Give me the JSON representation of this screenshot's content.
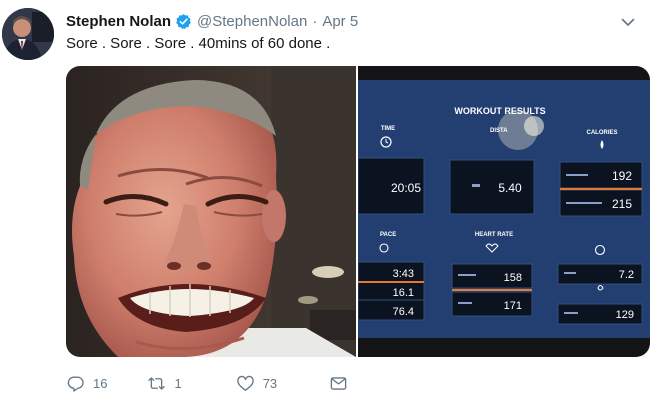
{
  "tweet": {
    "author_name": "Stephen Nolan",
    "handle": "@StephenNolan",
    "separator": "·",
    "date": "Apr 5",
    "text": "Sore . Sore . Sore . 40mins of 60 done .",
    "verified": true
  },
  "screen": {
    "title": "WORKOUT RESULTS",
    "top_labels": {
      "time": "TIME",
      "distance": "DISTA",
      "calories": "CALORIES"
    },
    "time_value": "20:05",
    "distance_value": "5.40",
    "calories": [
      "192",
      "215"
    ],
    "pace_label": "PACE",
    "heart_rate_label": "HEART RATE",
    "pace": [
      "3:43",
      "16.1",
      "76.4"
    ],
    "heart_rate": [
      "158",
      "171"
    ],
    "mets": "7.2",
    "watts": "129"
  },
  "actions": {
    "reply_count": "16",
    "retweet_count": "1",
    "like_count": "73"
  },
  "icons": [
    "verified-badge-icon",
    "chevron-down-icon",
    "reply-icon",
    "retweet-icon",
    "like-icon",
    "direct-message-icon"
  ],
  "colors": {
    "verified_blue": "#1da1f2",
    "muted_text": "#657786",
    "treadmill_screen": "#1f3766",
    "readout_box": "#0b1220"
  }
}
